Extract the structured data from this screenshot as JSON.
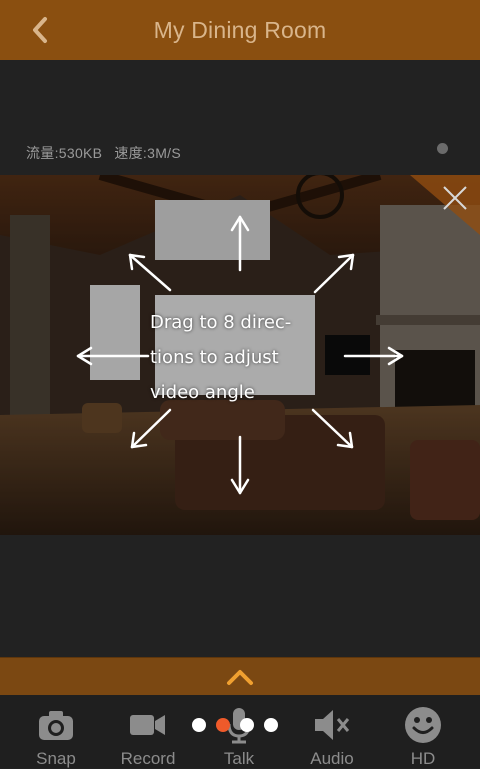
{
  "header": {
    "title": "My Dining Room",
    "back_icon": "back-chevron-icon"
  },
  "stats": {
    "traffic": "流量:530KB",
    "speed": "速度:3M/S"
  },
  "video": {
    "hint_lines": [
      "Drag to 8 direc-",
      "tions to adjust",
      "video angle"
    ],
    "close_icon": "close-icon"
  },
  "expand": {
    "icon": "chevron-up-icon"
  },
  "toolbar": {
    "items": [
      {
        "label": "Snap",
        "icon": "camera-icon"
      },
      {
        "label": "Record",
        "icon": "video-camera-icon"
      },
      {
        "label": "Talk",
        "icon": "microphone-icon"
      },
      {
        "label": "Audio",
        "icon": "speaker-mute-icon"
      },
      {
        "label": "HD",
        "icon": "smiley-icon"
      }
    ]
  },
  "pager": {
    "count": 4,
    "active_index": 1
  },
  "colors": {
    "header": "#8a4f10",
    "accent": "#ef5a2a",
    "background": "#222222",
    "title_text": "#d9b58b"
  }
}
